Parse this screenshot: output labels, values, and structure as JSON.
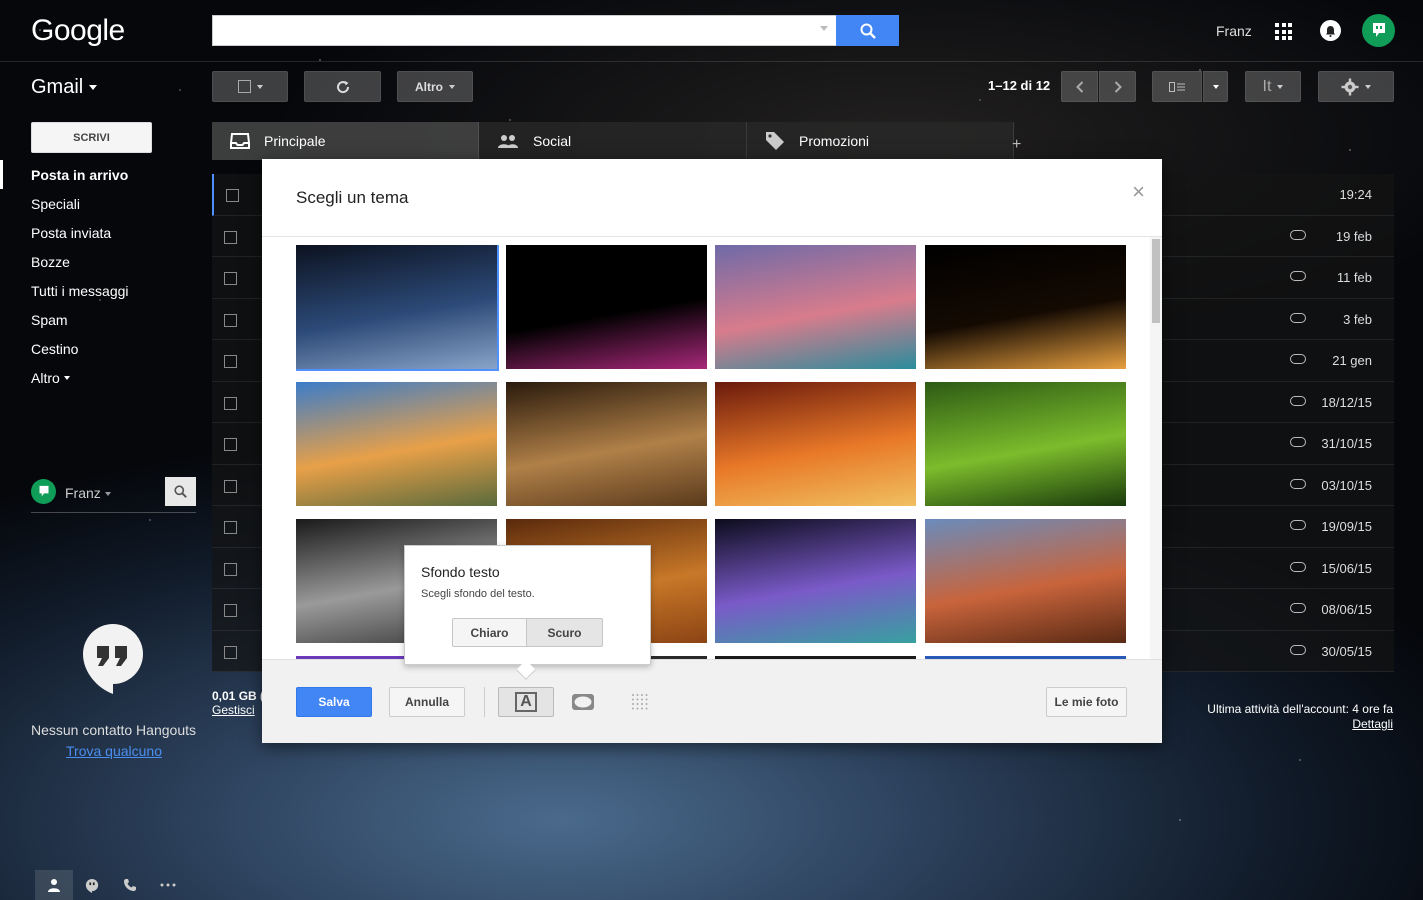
{
  "header": {
    "logo": "Google",
    "search": {
      "value": "",
      "placeholder": ""
    },
    "user_name": "Franz"
  },
  "toolbar": {
    "app_label": "Gmail",
    "more_label": "Altro",
    "paging": "1–12 di 12",
    "density_label": "It"
  },
  "sidebar": {
    "compose_label": "SCRIVI",
    "items": [
      {
        "label": "Posta in arrivo",
        "active": true
      },
      {
        "label": "Speciali"
      },
      {
        "label": "Posta inviata"
      },
      {
        "label": "Bozze"
      },
      {
        "label": "Tutti i messaggi"
      },
      {
        "label": "Spam"
      },
      {
        "label": "Cestino"
      },
      {
        "label": "Altro"
      }
    ],
    "hangouts_user": "Franz",
    "no_contacts": "Nessun contatto Hangouts",
    "find_someone": "Trova qualcuno"
  },
  "tabs": [
    {
      "label": "Principale"
    },
    {
      "label": "Social"
    },
    {
      "label": "Promozioni"
    }
  ],
  "messages": [
    {
      "date": "19:24",
      "attachment": false
    },
    {
      "date": "19 feb",
      "attachment": true
    },
    {
      "date": "11 feb",
      "attachment": true
    },
    {
      "date": "3 feb",
      "attachment": true
    },
    {
      "date": "21 gen",
      "attachment": true
    },
    {
      "date": "18/12/15",
      "attachment": true
    },
    {
      "date": "31/10/15",
      "attachment": true
    },
    {
      "date": "03/10/15",
      "attachment": true
    },
    {
      "date": "19/09/15",
      "attachment": true
    },
    {
      "date": "15/06/15",
      "attachment": true
    },
    {
      "date": "08/06/15",
      "attachment": true
    },
    {
      "date": "30/05/15",
      "attachment": true
    }
  ],
  "storage": {
    "used": "0,01 GB (",
    "manage": "Gestisci"
  },
  "last_activity": {
    "text": "Ultima attività dell'account: 4 ore fa",
    "details": "Dettagli"
  },
  "theme_dialog": {
    "title": "Scegli un tema",
    "close": "×",
    "themes": [
      {
        "name": "earth-from-space",
        "colors": [
          "#0c1220",
          "#2c4a78",
          "#8aa4c8"
        ],
        "selected": true
      },
      {
        "name": "colour-explosion",
        "colors": [
          "#000000",
          "#000000",
          "#a8287a"
        ]
      },
      {
        "name": "city-illustration",
        "colors": [
          "#6e6aa8",
          "#d87c8c",
          "#2a8c9c"
        ]
      },
      {
        "name": "jack-o-lantern",
        "colors": [
          "#000000",
          "#140a02",
          "#e8a040"
        ]
      },
      {
        "name": "golden-gate",
        "colors": [
          "#3c7cc8",
          "#e8a048",
          "#5a6a3c"
        ]
      },
      {
        "name": "chess-pieces",
        "colors": [
          "#2a1a0c",
          "#b08048",
          "#5a3a1c"
        ]
      },
      {
        "name": "canyon-waves",
        "colors": [
          "#6a1a0c",
          "#e87828",
          "#f0c060"
        ]
      },
      {
        "name": "caterpillar",
        "colors": [
          "#2c5a14",
          "#7cbc2c",
          "#1a3a0c"
        ]
      },
      {
        "name": "metal-pipes",
        "colors": [
          "#1a1a1a",
          "#9a9a9a",
          "#3a3a3a"
        ]
      },
      {
        "name": "autumn-leaves",
        "colors": [
          "#5a2a0c",
          "#c87828",
          "#8c4414"
        ]
      },
      {
        "name": "bokeh-lights",
        "colors": [
          "#0c0c1c",
          "#7a5ac8",
          "#38a0a0"
        ]
      },
      {
        "name": "horseshoe-bend",
        "colors": [
          "#6a8cbc",
          "#c8643c",
          "#5a2a14"
        ]
      }
    ],
    "save_label": "Salva",
    "cancel_label": "Annulla",
    "text_bg_icon_label": "A",
    "my_photos_label": "Le mie foto"
  },
  "text_bg_popup": {
    "title": "Sfondo testo",
    "description": "Scegli sfondo del testo.",
    "light_label": "Chiaro",
    "dark_label": "Scuro"
  },
  "colors": {
    "accent": "#4285f4",
    "hangouts_green": "#0f9d58",
    "selected_outline": "#4d90fe"
  }
}
